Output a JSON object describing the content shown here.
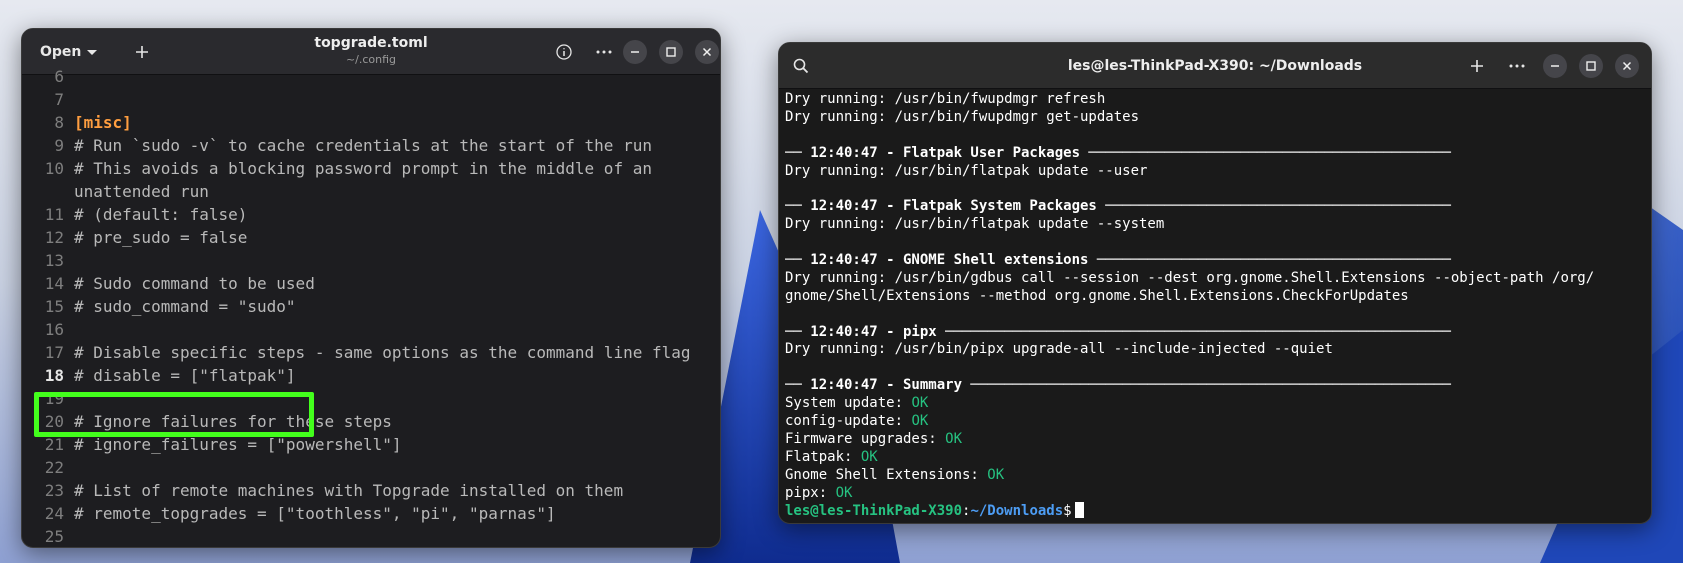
{
  "editor": {
    "open_label": "Open",
    "title": "topgrade.toml",
    "subtitle": "~/.config",
    "lines": [
      {
        "n": "6",
        "text": ""
      },
      {
        "n": "7",
        "text": ""
      },
      {
        "n": "8",
        "text": "[misc]"
      },
      {
        "n": "9",
        "text": "# Run `sudo -v` to cache credentials at the start of the run"
      },
      {
        "n": "10",
        "text": "# This avoids a blocking password prompt in the middle of an"
      },
      {
        "n": "",
        "text": "unattended run"
      },
      {
        "n": "11",
        "text": "# (default: false)"
      },
      {
        "n": "12",
        "text": "# pre_sudo = false"
      },
      {
        "n": "13",
        "text": ""
      },
      {
        "n": "14",
        "text": "# Sudo command to be used"
      },
      {
        "n": "15",
        "text": "# sudo_command = \"sudo\""
      },
      {
        "n": "16",
        "text": ""
      },
      {
        "n": "17",
        "text": "# Disable specific steps - same options as the command line flag"
      },
      {
        "n": "18",
        "text": "# disable = [\"flatpak\"]"
      },
      {
        "n": "19",
        "text": ""
      },
      {
        "n": "20",
        "text": "# Ignore failures for these steps"
      },
      {
        "n": "21",
        "text": "# ignore_failures = [\"powershell\"]"
      },
      {
        "n": "22",
        "text": ""
      },
      {
        "n": "23",
        "text": "# List of remote machines with Topgrade installed on them"
      },
      {
        "n": "24",
        "text": "# remote_topgrades = [\"toothless\", \"pi\", \"parnas\"]"
      },
      {
        "n": "25",
        "text": ""
      }
    ]
  },
  "terminal": {
    "title": "les@les-ThinkPad-X390: ~/Downloads",
    "lines": [
      "Dry running: /usr/bin/fwupdmgr refresh",
      "Dry running: /usr/bin/fwupdmgr get-updates",
      "",
      "── 12:40:47 - Flatpak User Packages ───────────────────────────────────────────",
      "Dry running: /usr/bin/flatpak update --user",
      "",
      "── 12:40:47 - Flatpak System Packages ─────────────────────────────────────────",
      "Dry running: /usr/bin/flatpak update --system",
      "",
      "── 12:40:47 - GNOME Shell extensions ──────────────────────────────────────────",
      "Dry running: /usr/bin/gdbus call --session --dest org.gnome.Shell.Extensions --object-path /org/",
      "gnome/Shell/Extensions --method org.gnome.Shell.Extensions.CheckForUpdates",
      "",
      "── 12:40:47 - pipx ────────────────────────────────────────────────────────────",
      "Dry running: /usr/bin/pipx upgrade-all --include-injected --quiet",
      "",
      "── 12:40:47 - Summary ─────────────────────────────────────────────────────────"
    ],
    "summary": [
      {
        "label": "System update: ",
        "status": "OK"
      },
      {
        "label": "config-update: ",
        "status": "OK"
      },
      {
        "label": "Firmware upgrades: ",
        "status": "OK"
      },
      {
        "label": "Flatpak: ",
        "status": "OK"
      },
      {
        "label": "Gnome Shell Extensions: ",
        "status": "OK"
      },
      {
        "label": "pipx: ",
        "status": "OK"
      }
    ],
    "prompt": {
      "user": "les@les-ThinkPad-X390",
      "sep": ":",
      "path": "~/Downloads",
      "symbol": "$"
    }
  },
  "colors": {
    "ok": "#26c281",
    "highlight": "#43ff1c",
    "section": "#ff9e40"
  }
}
